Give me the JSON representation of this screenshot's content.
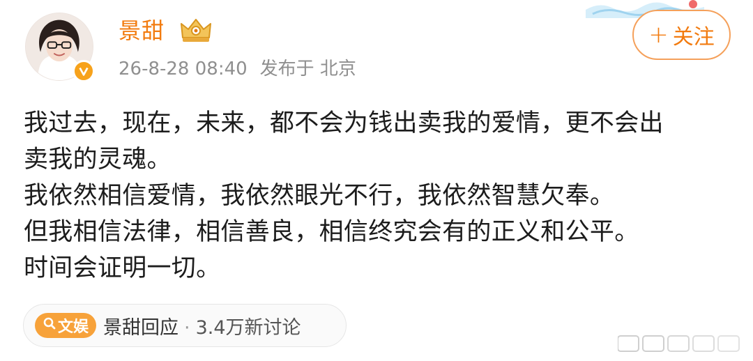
{
  "user": {
    "name": "景甜",
    "avatar_icon": "user-avatar",
    "verified_icon": "verified-badge-icon",
    "badge_icon": "crown-member-icon"
  },
  "post": {
    "date": "26-8-28 08:40",
    "location_label": "发布于 北京",
    "lines": [
      "我过去，现在，未来，都不会为钱出卖我的爱情，更不会出",
      "卖我的灵魂。",
      "我依然相信爱情，我依然眼光不行，我依然智慧欠奉。",
      "但我相信法律，相信善良，相信终究会有的正义和公平。",
      "时间会证明一切。"
    ]
  },
  "follow_button": {
    "plus": "+",
    "label": "关注"
  },
  "topic": {
    "tag_label": "文娱",
    "tag_icon": "search-icon",
    "title": "景甜回应",
    "separator": "·",
    "count": "3.4万新讨论"
  },
  "colors": {
    "accent": "#f27b0f",
    "tag_bg": "#f7a23a",
    "meta_text": "#8f8f8f"
  }
}
